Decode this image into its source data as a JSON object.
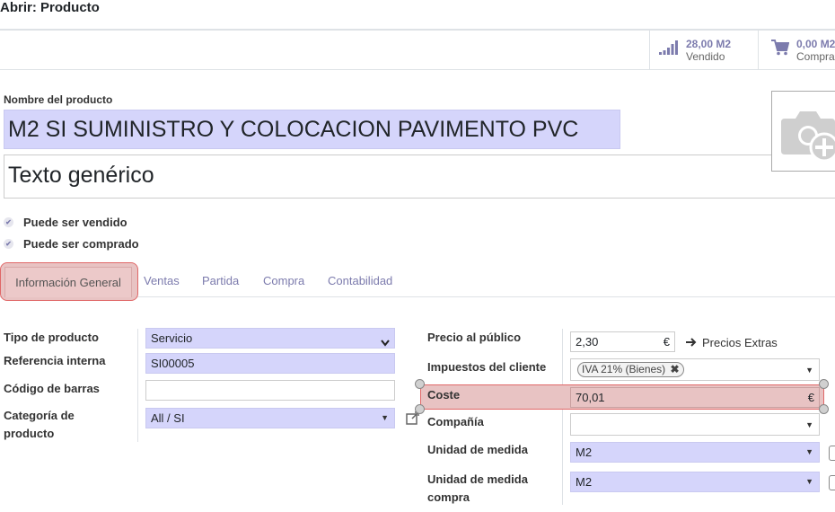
{
  "window": {
    "title": "Abrir: Producto"
  },
  "stats": [
    {
      "value": "28,00 M2",
      "label": "Vendido",
      "icon": "bar-chart-icon"
    },
    {
      "value": "0,00 M2",
      "label": "Compra",
      "icon": "cart-icon"
    }
  ],
  "product": {
    "name_label": "Nombre del producto",
    "name": "M2 SI  SUMINISTRO Y COLOCACION PAVIMENTO PVC",
    "generic_text": "Texto genérico",
    "can_be_sold_label": "Puede ser vendido",
    "can_be_purchased_label": "Puede ser comprado"
  },
  "tabs": [
    {
      "label": "Información General",
      "active": true
    },
    {
      "label": "Ventas"
    },
    {
      "label": "Partida"
    },
    {
      "label": "Compra"
    },
    {
      "label": "Contabilidad"
    }
  ],
  "left_fields": {
    "type_label": "Tipo de producto",
    "type_value": "Servicio",
    "ref_label": "Referencia interna",
    "ref_value": "SI00005",
    "barcode_label": "Código de barras",
    "barcode_value": "",
    "category_label_1": "Categoría de",
    "category_label_2": "producto",
    "category_value": "All / SI"
  },
  "right_fields": {
    "price_label": "Precio al público",
    "price_value": "2,30",
    "currency": "€",
    "extra_prices_label": "Precios Extras",
    "taxes_label": "Impuestos del cliente",
    "tax_tag": "IVA 21% (Bienes)",
    "cost_label": "Coste",
    "cost_value": "70,01",
    "company_label": "Compañía",
    "company_value": "",
    "uom_label": "Unidad de medida",
    "uom_value": "M2",
    "uom_purchase_label_1": "Unidad de medida",
    "uom_purchase_label_2": "compra",
    "uom_purchase_value": "M2"
  },
  "colors": {
    "accent": "#7c7bad",
    "highlight": "#e8c3c3",
    "highlight_border": "#e06868",
    "field_bg": "#d5d5fb"
  }
}
